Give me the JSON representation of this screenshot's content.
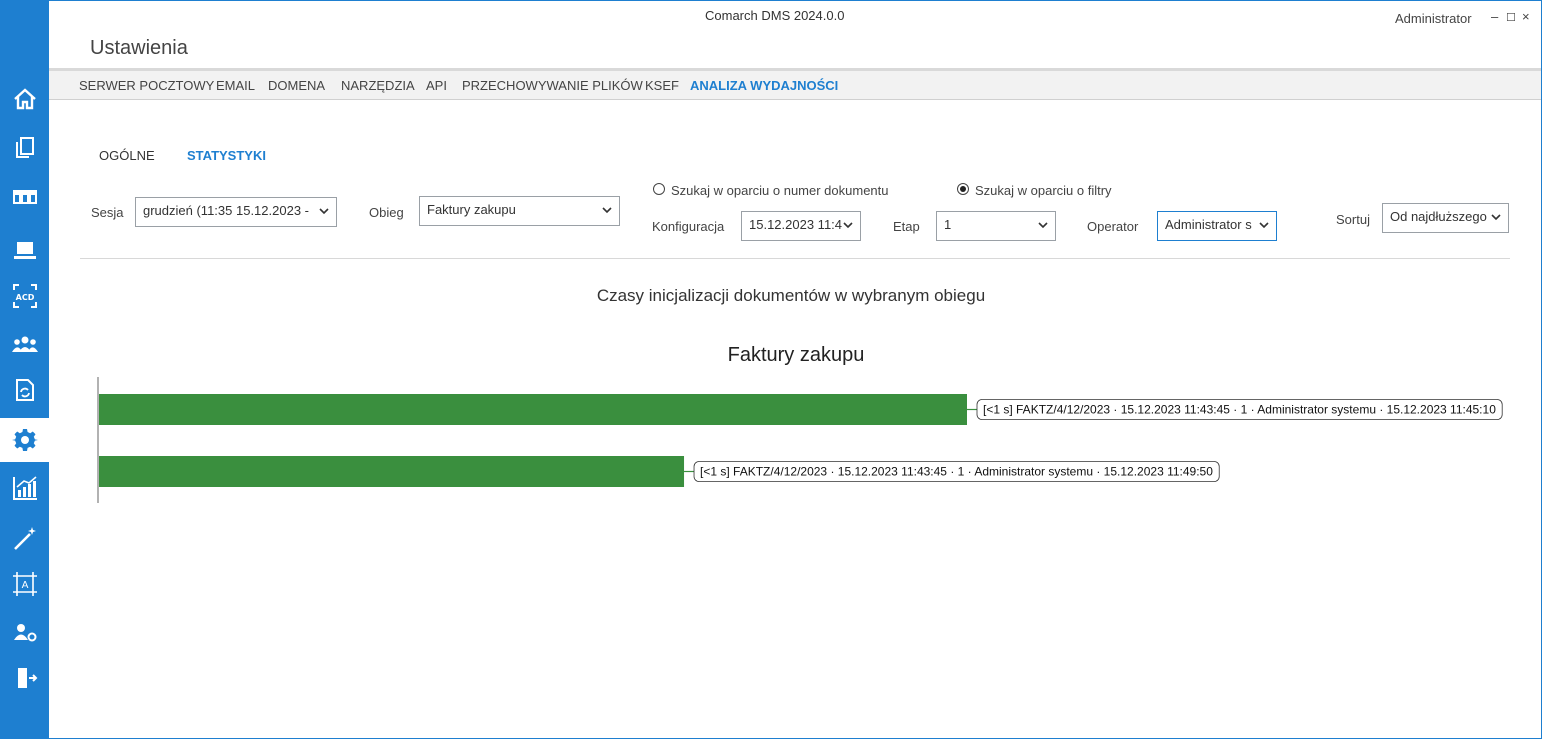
{
  "window": {
    "title": "Comarch DMS 2024.0.0",
    "user": "Administrator",
    "minimize": "–",
    "maximize": "☐",
    "close": "×"
  },
  "page_title": "Ustawienia",
  "tabs": [
    {
      "label": "SERWER POCZTOWY"
    },
    {
      "label": "EMAIL"
    },
    {
      "label": "DOMENA"
    },
    {
      "label": "NARZĘDZIA"
    },
    {
      "label": "API"
    },
    {
      "label": "PRZECHOWYWANIE PLIKÓW"
    },
    {
      "label": "KSEF"
    },
    {
      "label": "ANALIZA WYDAJNOŚCI",
      "active": true
    }
  ],
  "subtabs": [
    {
      "label": "OGÓLNE"
    },
    {
      "label": "STATYSTYKI",
      "active": true
    }
  ],
  "filters": {
    "session_label": "Sesja",
    "session_value": "grudzień (11:35 15.12.2023 -",
    "workflow_label": "Obieg",
    "workflow_value": "Faktury zakupu",
    "radio_number_label": "Szukaj w oparciu o numer dokumentu",
    "radio_filters_label": "Szukaj w oparciu o filtry",
    "config_label": "Konfiguracja",
    "config_value": "15.12.2023 11:4",
    "stage_label": "Etap",
    "stage_value": "1",
    "operator_label": "Operator",
    "operator_value": "Administrator s",
    "sort_label": "Sortuj",
    "sort_value": "Od najdłuższego"
  },
  "sidebar": [
    {
      "icon": "home-icon"
    },
    {
      "icon": "documents-icon"
    },
    {
      "icon": "workflow-icon"
    },
    {
      "icon": "laptop-icon"
    },
    {
      "icon": "ocr-acd-icon"
    },
    {
      "icon": "users-icon"
    },
    {
      "icon": "document-sync-icon"
    },
    {
      "icon": "gear-icon",
      "active": true
    },
    {
      "icon": "analytics-chart-icon"
    },
    {
      "icon": "magic-wand-icon"
    },
    {
      "icon": "template-designer-icon"
    },
    {
      "icon": "user-settings-icon"
    },
    {
      "icon": "logout-icon"
    }
  ],
  "colors": {
    "accent": "#1e7fd0",
    "bar": "#3a8f3e"
  },
  "chart_heading": "Czasy inicjalizacji dokumentów w wybranym obiegu",
  "chart_data": {
    "type": "bar",
    "orientation": "horizontal",
    "title": "Faktury zakupu",
    "bars": [
      {
        "label": "[<1 s] FAKTZ/4/12/2023 · 15.12.2023 11:43:45 · 1 · Administrator systemu · 15.12.2023 11:45:10",
        "value": 1.0
      },
      {
        "label": "[<1 s] FAKTZ/4/12/2023 · 15.12.2023 11:43:45 · 1 · Administrator systemu · 15.12.2023 11:49:50",
        "value": 0.674
      }
    ],
    "grid": false,
    "legend": "none"
  }
}
